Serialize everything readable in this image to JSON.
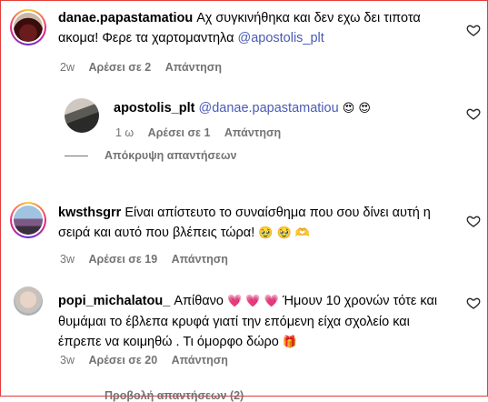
{
  "comments": [
    {
      "username": "danae.papastamatiou",
      "text": "Αχ συγκινήθηκα και δεν εχω δει τιποτα ακομα! Φερε τα χαρτομαντηλα",
      "mention": "@apostolis_plt",
      "time": "2w",
      "likes": "Αρέσει σε 2",
      "reply": "Απάντηση"
    },
    {
      "username": "apostolis_plt",
      "mention": "@danae.papastamatiou",
      "emoji": "😍 😍",
      "time": "1 ω",
      "likes": "Αρέσει σε 1",
      "reply": "Απάντηση"
    },
    {
      "username": "kwsthsgrr",
      "text": "Είναι απίστευτο το συναίσθημα που σου δίνει αυτή η σειρά και αυτό που βλέπεις τώρα!",
      "emoji": "🥹 🥹 🫶",
      "time": "3w",
      "likes": "Αρέσει σε 19",
      "reply": "Απάντηση"
    },
    {
      "username": "popi_michalatou_",
      "text_a": "Απίθανο",
      "hearts": "💗 💗 💗",
      "text_b": "Ήμουν 10 χρονών τότε και θυμάμαι το έβλεπα κρυφά γιατί την επόμενη είχα σχολείο και έπρεπε να κοιμηθώ . Τι όμορφο δώρο",
      "gift": "🎁",
      "time": "3w",
      "likes": "Αρέσει σε 20",
      "reply": "Απάντηση"
    }
  ],
  "hide_replies": "Απόκρυψη απαντήσεων",
  "view_replies_cut": "Προβολή απαντήσεων (2)"
}
